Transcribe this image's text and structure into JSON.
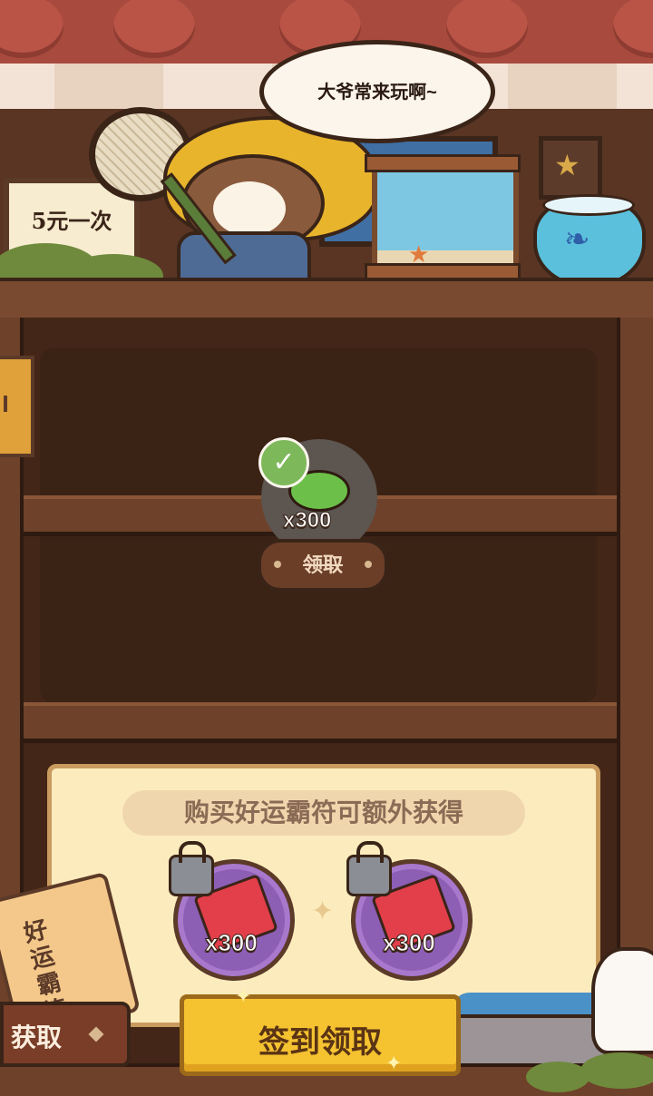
{
  "scene": {
    "speech_bubble": "大爷常来玩啊~",
    "price_sign": "5元一次"
  },
  "daily_reward": {
    "quantity": "x300",
    "status_button": "领取",
    "claimed": true
  },
  "luck_panel": {
    "title": "购买好运霸符可额外获得",
    "rewards": [
      {
        "quantity": "x300",
        "locked": true,
        "icon": "red-scroll-icon"
      },
      {
        "quantity": "x300",
        "locked": true,
        "icon": "red-scroll-icon"
      }
    ]
  },
  "bottom_bar": {
    "charm_label": "好运霸符",
    "get_button": "获取",
    "sign_in_button": "签到领取"
  }
}
